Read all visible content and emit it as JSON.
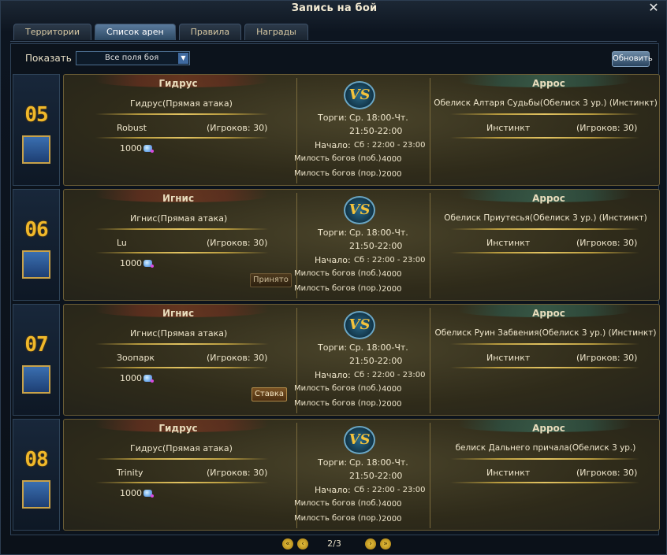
{
  "window": {
    "title": "Запись на бой"
  },
  "tabs": [
    {
      "label": "Территории",
      "active": false
    },
    {
      "label": "Список арен",
      "active": true
    },
    {
      "label": "Правила",
      "active": false
    },
    {
      "label": "Награды",
      "active": false
    }
  ],
  "filter": {
    "label": "Показать",
    "selected": "Все поля боя",
    "refresh_label": "Обновить"
  },
  "labels": {
    "bidding": "Торги:",
    "start": "Начало:",
    "favor_win": "Милость богов (поб.)",
    "favor_lose": "Милость богов (пор.)"
  },
  "arenas": [
    {
      "number": "05",
      "left": {
        "faction": "Гидрус",
        "subtitle": "Гидрус(Прямая атака)",
        "leader": "Robust",
        "players": "(Игроков: 30)",
        "bid": "1000"
      },
      "center": {
        "bid_time_1": "Ср. 18:00-Чт.",
        "bid_time_2": "21:50-22:00",
        "start_time": "Сб : 22:00 - 23:00",
        "favor_win": "4000",
        "favor_lose": "2000"
      },
      "right": {
        "faction": "Аррос",
        "subtitle": "Обелиск Алтаря Судьбы(Обелиск 3 ур.) (Инстинкт)",
        "leader": "Инстинкт",
        "players": "(Игроков: 30)"
      },
      "action": ""
    },
    {
      "number": "06",
      "left": {
        "faction": "Игнис",
        "subtitle": "Игнис(Прямая атака)",
        "leader": "Lu",
        "players": "(Игроков: 30)",
        "bid": "1000"
      },
      "center": {
        "bid_time_1": "Ср. 18:00-Чт.",
        "bid_time_2": "21:50-22:00",
        "start_time": "Сб : 22:00 - 23:00",
        "favor_win": "4000",
        "favor_lose": "2000"
      },
      "right": {
        "faction": "Аррос",
        "subtitle": "Обелиск Приутесья(Обелиск 3 ур.) (Инстинкт)",
        "leader": "Инстинкт",
        "players": "(Игроков: 30)"
      },
      "action": "Принято"
    },
    {
      "number": "07",
      "left": {
        "faction": "Игнис",
        "subtitle": "Игнис(Прямая атака)",
        "leader": "Зоопарк",
        "players": "(Игроков: 30)",
        "bid": "1000"
      },
      "center": {
        "bid_time_1": "Ср. 18:00-Чт.",
        "bid_time_2": "21:50-22:00",
        "start_time": "Сб : 22:00 - 23:00",
        "favor_win": "4000",
        "favor_lose": "2000"
      },
      "right": {
        "faction": "Аррос",
        "subtitle": "Обелиск Руин Забвения(Обелиск 3 ур.) (Инстинкт)",
        "leader": "Инстинкт",
        "players": "(Игроков: 30)"
      },
      "action": "Ставка"
    },
    {
      "number": "08",
      "left": {
        "faction": "Гидрус",
        "subtitle": "Гидрус(Прямая атака)",
        "leader": "Trinity",
        "players": "(Игроков: 30)",
        "bid": "1000"
      },
      "center": {
        "bid_time_1": "Ср. 18:00-Чт.",
        "bid_time_2": "21:50-22:00",
        "start_time": "Сб : 22:00 - 23:00",
        "favor_win": "4000",
        "favor_lose": "2000"
      },
      "right": {
        "faction": "Аррос",
        "subtitle": "белиск Дальнего причала(Обелиск 3 ур.)",
        "leader": "Инстинкт",
        "players": "(Игроков: 30)"
      },
      "action": ""
    }
  ],
  "pager": {
    "text": "2/3"
  },
  "icons": {
    "close": "close-icon",
    "dropdown": "chevron-down-icon",
    "arena": "gavel-icon",
    "currency": "diamond-icon",
    "vs": "vs-emblem-icon",
    "pager_first": "double-chevron-left-icon",
    "pager_prev": "chevron-left-icon",
    "pager_next": "chevron-right-icon",
    "pager_last": "double-chevron-right-icon"
  },
  "colors": {
    "accent_gold": "#f0b82a",
    "panel_bg": "#2f2b1a",
    "vs_blue": "#2a6a8a"
  }
}
